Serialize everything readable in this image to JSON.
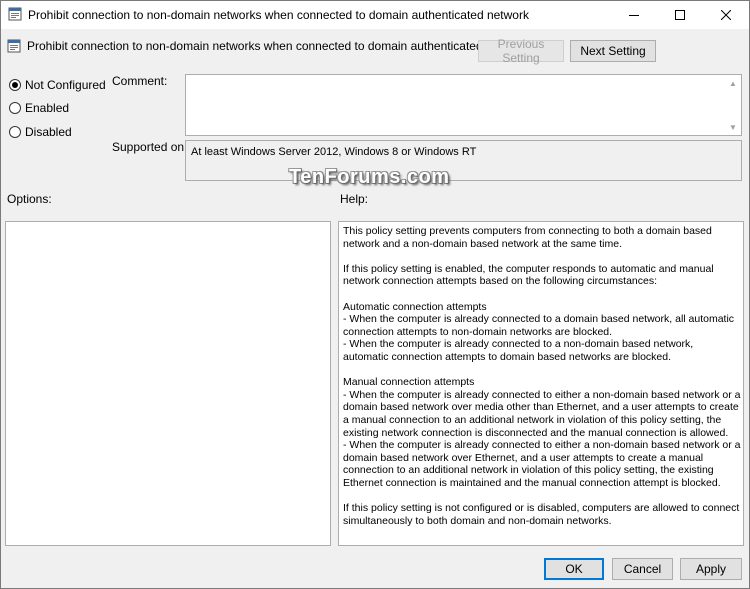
{
  "window": {
    "title": "Prohibit connection to non-domain networks when connected to domain authenticated network",
    "minimize_icon": "minimize-icon",
    "maximize_icon": "maximize-icon",
    "close_icon": "close-icon"
  },
  "header": {
    "policy_name": "Prohibit connection to non-domain networks when connected to domain authenticated network",
    "previous_label": "Previous Setting",
    "next_label": "Next Setting"
  },
  "state": {
    "options": [
      {
        "label": "Not Configured",
        "checked": true
      },
      {
        "label": "Enabled",
        "checked": false
      },
      {
        "label": "Disabled",
        "checked": false
      }
    ]
  },
  "comment": {
    "label": "Comment:",
    "value": ""
  },
  "supported": {
    "label": "Supported on:",
    "value": "At least Windows Server 2012, Windows 8 or Windows RT"
  },
  "watermark": "TenForums.com",
  "options_label": "Options:",
  "help": {
    "label": "Help:",
    "paragraphs": [
      "This policy setting prevents computers from connecting to both a domain based network and a non-domain based network at the same time.",
      "If this policy setting is enabled, the computer responds to automatic and manual network connection attempts based on the following circumstances:",
      "Automatic connection attempts\n- When the computer is already connected to a domain based network, all automatic connection attempts to non-domain networks are blocked.\n- When the computer is already connected to a non-domain based network, automatic connection attempts to domain based networks are blocked.",
      "Manual connection attempts\n- When the computer is already connected to either a non-domain based network or a domain based network over media other than Ethernet, and a user attempts to create a manual connection to an additional network in violation of this policy setting, the existing network connection is disconnected and the manual connection is allowed.\n- When the computer is already connected to either a non-domain based network or a domain based network over Ethernet, and a user attempts to create a manual connection to an additional network in violation of this policy setting, the existing Ethernet connection is maintained and the manual connection attempt is blocked.",
      "If this policy setting is not configured or is disabled, computers are allowed to connect simultaneously to both domain and non-domain networks."
    ]
  },
  "footer": {
    "ok_label": "OK",
    "cancel_label": "Cancel",
    "apply_label": "Apply"
  }
}
